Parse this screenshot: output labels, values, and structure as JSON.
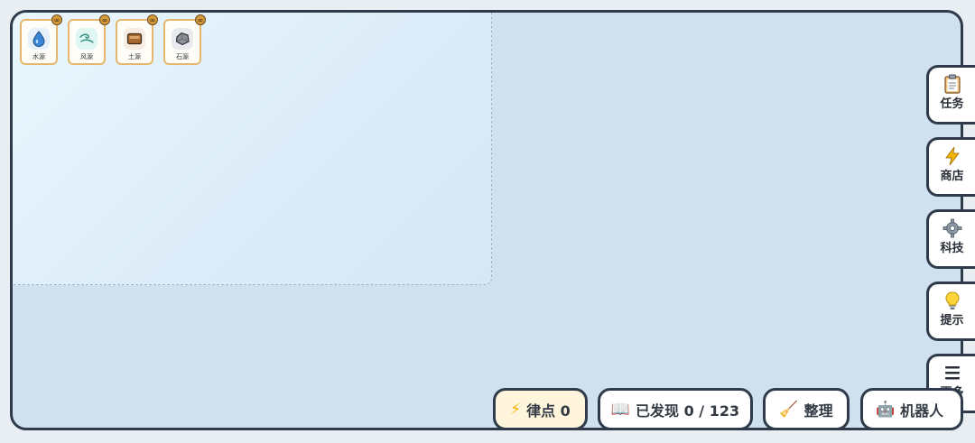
{
  "sources": [
    {
      "label": "水源",
      "icon": "water-drop-icon",
      "bg": "#e6f1fb"
    },
    {
      "label": "风源",
      "icon": "wind-icon",
      "bg": "#dff6f2"
    },
    {
      "label": "土源",
      "icon": "soil-icon",
      "bg": "#f6ece2"
    },
    {
      "label": "石源",
      "icon": "stone-icon",
      "bg": "#e8eaed"
    }
  ],
  "infinity_badge": "∞",
  "side_menu": [
    {
      "label": "任务",
      "emoji": "📋",
      "icon": "clipboard-icon"
    },
    {
      "label": "商店",
      "emoji": "⚡",
      "icon": "lightning-icon"
    },
    {
      "label": "科技",
      "emoji": "⚙️",
      "icon": "gear-icon"
    },
    {
      "label": "提示",
      "emoji": "💡",
      "icon": "lightbulb-icon"
    },
    {
      "label": "更多",
      "emoji": "☰",
      "icon": "menu-icon"
    }
  ],
  "bottom_bar": {
    "points": {
      "emoji": "⚡",
      "label": "律点 0",
      "icon": "lightning-icon"
    },
    "discovered": {
      "emoji": "📖",
      "label": "已发现 0 / 123",
      "icon": "book-icon"
    },
    "tidy": {
      "emoji": "🧹",
      "label": "整理",
      "icon": "broom-icon"
    },
    "robot": {
      "emoji": "🤖",
      "label": "机器人",
      "icon": "robot-icon"
    }
  },
  "colors": {
    "board": "#cfe0ee",
    "zone": "#e3f2fb",
    "border": "#2f3a4a",
    "card_border": "#e7b66e",
    "points_bg": "#fff4dc"
  }
}
